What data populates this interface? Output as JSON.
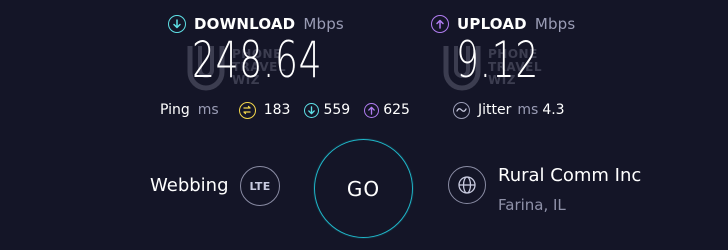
{
  "download": {
    "label": "DOWNLOAD",
    "unit": "Mbps",
    "value": "248.64"
  },
  "upload": {
    "label": "UPLOAD",
    "unit": "Mbps",
    "value": "9.12"
  },
  "watermark": {
    "line1": "PHONE",
    "line2": "TRAVEL",
    "line3": "WIZ"
  },
  "ping": {
    "label": "Ping",
    "unit": "ms",
    "idle": "183",
    "download": "559",
    "upload": "625"
  },
  "jitter": {
    "label": "Jitter",
    "unit": "ms",
    "value": "4.3"
  },
  "go_label": "GO",
  "network": {
    "name": "Webbing",
    "type": "LTE"
  },
  "provider": {
    "name": "Rural Comm Inc",
    "location": "Farina, IL"
  },
  "colors": {
    "background": "#141527",
    "download_accent": "#5ee0e6",
    "upload_accent": "#b07cf0",
    "idle_accent": "#f2d64b",
    "go_ring": "#1fb6c8"
  }
}
